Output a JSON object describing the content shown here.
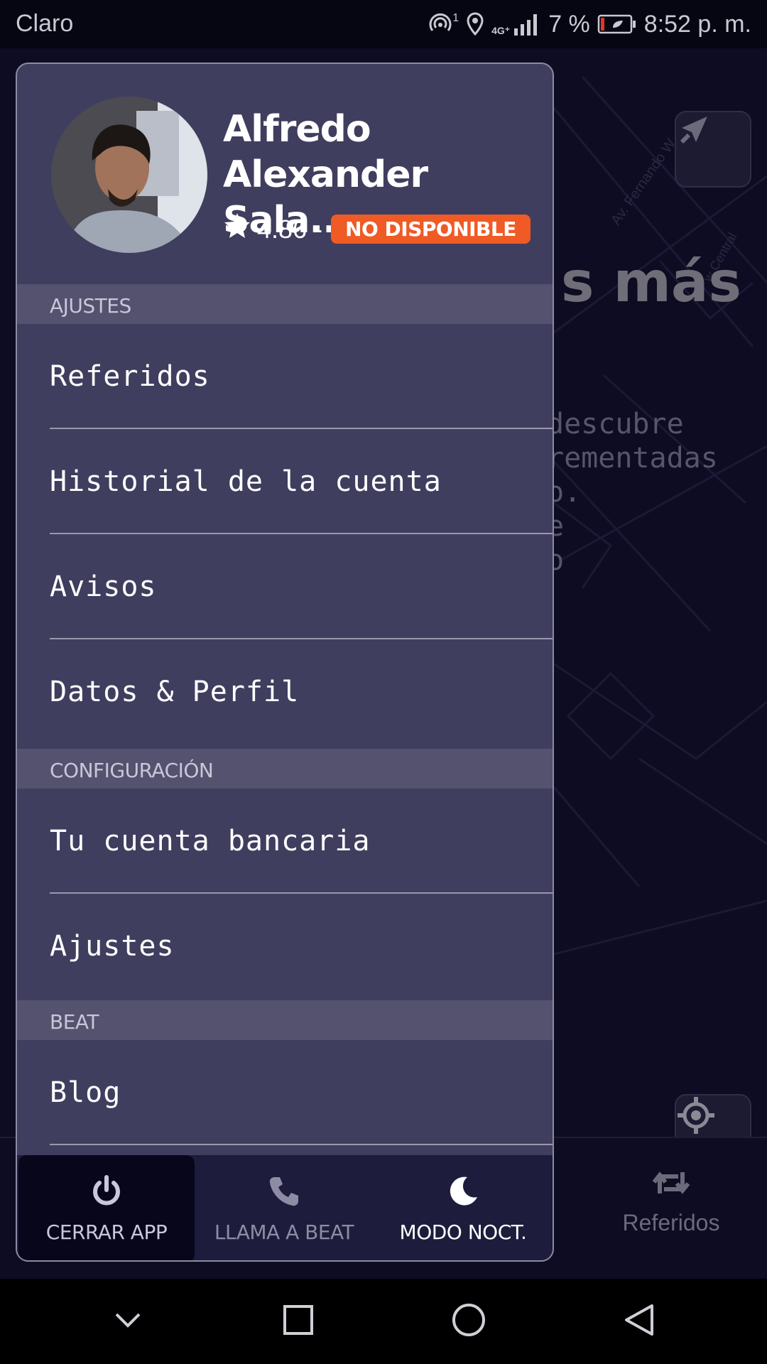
{
  "status_bar": {
    "carrier": "Claro",
    "network_sup": "1",
    "network_type": "4G⁺",
    "battery_percent": "7 %",
    "time": "8:52 p. m."
  },
  "background": {
    "heading_partial": "s más",
    "text_partial": "descubre\nrementadas\no.\ne\no",
    "street_label_1": "Av. Fernando W",
    "street_label_2": "w Central"
  },
  "tab_bar": {
    "referidos_label": "Referidos"
  },
  "drawer": {
    "profile": {
      "name": "Alfredo Alexander Sala...",
      "rating": "4.86 -",
      "status_badge": "NO DISPONIBLE"
    },
    "sections": [
      {
        "title": "AJUSTES",
        "items": [
          "Referidos",
          "Historial de la cuenta",
          "Avisos",
          "Datos & Perfil"
        ]
      },
      {
        "title": "CONFIGURACIÓN",
        "items": [
          "Tu cuenta bancaria",
          "Ajustes"
        ]
      },
      {
        "title": "BEAT",
        "items": [
          "Blog"
        ]
      }
    ],
    "footer": [
      {
        "label": "CERRAR APP",
        "icon": "power-icon",
        "color": "#c9c7d9"
      },
      {
        "label": "LLAMA A BEAT",
        "icon": "phone-icon",
        "color": "#8e8ca4"
      },
      {
        "label": "MODO NOCT.",
        "icon": "moon-icon",
        "color": "#ffffff"
      }
    ]
  },
  "colors": {
    "drawer_bg": "#403e5e",
    "section_bg": "#54526f",
    "badge": "#f05a24",
    "footer_bg": "#1e1c3c"
  }
}
